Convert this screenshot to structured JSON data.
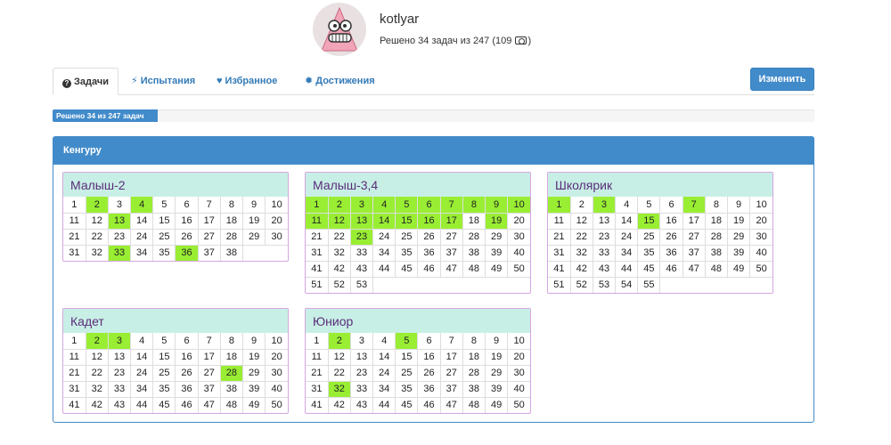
{
  "profile": {
    "username": "kotlyar",
    "stats_text": "Решено 34 задач из 247 (109",
    "stats_suffix": ")",
    "avatar_icon": "smiling-face-avatar-icon",
    "coin_icon": "coin-icon"
  },
  "tabs": [
    {
      "label": "Задачи",
      "icon": "question-circle-icon",
      "glyph": "?",
      "active": true
    },
    {
      "label": "Испытания",
      "icon": "lightning-icon",
      "glyph": "⚡",
      "active": false
    },
    {
      "label": "Избранное",
      "icon": "heart-icon",
      "glyph": "♥",
      "active": false
    },
    {
      "label": "Достижения",
      "icon": "certificate-icon",
      "glyph": "✹",
      "active": false
    }
  ],
  "edit_button_label": "Изменить",
  "progress": {
    "label": "Решено 34 из 247 задач",
    "solved": 34,
    "total": 247
  },
  "panel_title": "Кенгуру",
  "colors": {
    "accent": "#428bca",
    "solved": "#99ee33",
    "title_bg": "#c8efe6",
    "title_text": "#5a2d7a",
    "border": "#d5a6e0"
  },
  "contests": [
    {
      "title": "Малыш-2",
      "count": 38,
      "solved": [
        2,
        4,
        13,
        33,
        36
      ]
    },
    {
      "title": "Малыш-3,4",
      "count": 53,
      "solved": [
        1,
        2,
        3,
        4,
        5,
        6,
        7,
        8,
        9,
        10,
        11,
        12,
        13,
        14,
        15,
        16,
        17,
        19,
        23
      ]
    },
    {
      "title": "Школярик",
      "count": 55,
      "solved": [
        1,
        3,
        7,
        15
      ]
    },
    {
      "title": "Кадет",
      "count": 50,
      "solved": [
        2,
        3,
        28
      ]
    },
    {
      "title": "Юниор",
      "count": 50,
      "solved": [
        2,
        5,
        32
      ]
    }
  ]
}
